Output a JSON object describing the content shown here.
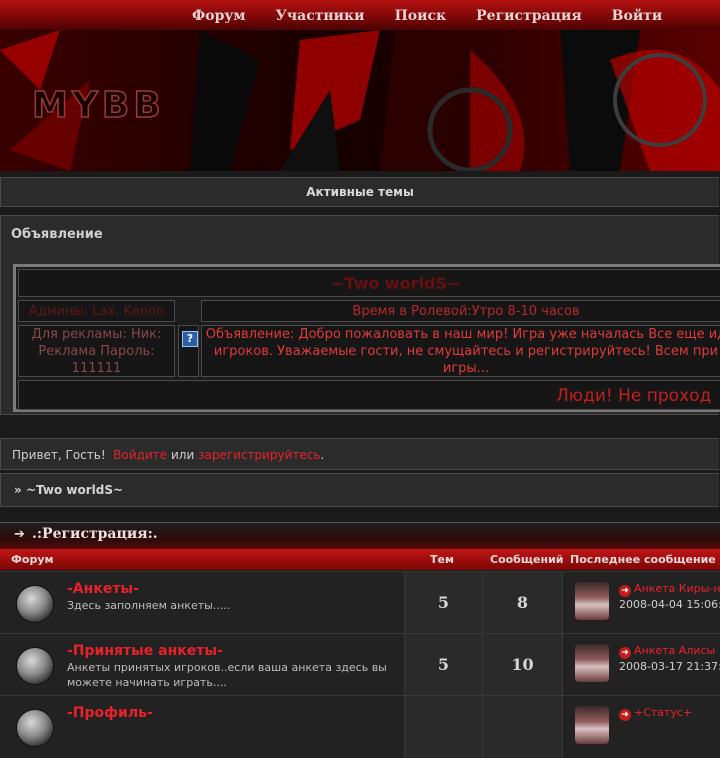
{
  "nav": {
    "items": [
      "Форум",
      "Участники",
      "Поиск",
      "Регистрация",
      "Войти"
    ]
  },
  "banner": {
    "logo_text": "MYBB"
  },
  "active_topics": "Активные темы",
  "announcement": {
    "heading": "Объявление",
    "title": "~Two worldS~",
    "admins": "Админы: Lax, Kanon",
    "time": "Время в Ролевой:Утро 8-10 часов",
    "ad_line1": "Для рекламы: Ник:",
    "ad_line2": "Реклама Пароль:",
    "ad_line3": "111111",
    "icon_glyph": "?",
    "text_line1": "Объявление: Добро пожаловать в наш мир! Игра уже началась Все еще ид",
    "text_line2": "игроков. Уважаемые гости, не смущайтесь и регистрируйтесь! Всем при",
    "text_line3": "игры...",
    "marquee": "Люди! Не проход"
  },
  "guest": {
    "greeting": "Привет, Гость!",
    "login": "Войдите",
    "or": "или",
    "register": "зарегистрируйтесь",
    "end": "."
  },
  "breadcrumb": {
    "sep": "»",
    "label": "~Two worldS~"
  },
  "category": {
    "arrow": "➔",
    "title": ".:Регистрация:."
  },
  "table_headers": {
    "forum": "Форум",
    "topics": "Тем",
    "posts": "Сообщений",
    "last": "Последнее сообщение"
  },
  "forums": [
    {
      "name": "-Анкеты-",
      "desc": "Здесь заполняем анкеты.....",
      "topics": "5",
      "posts": "8",
      "last_title": "Анкета Киры-н",
      "last_date": "2008-04-04 15:06:"
    },
    {
      "name": "-Принятые анкеты-",
      "desc": "Анкеты принятых игроков..если ваша анкета здесь вы можете начинать играть....",
      "topics": "5",
      "posts": "10",
      "last_title": "Анкета Алисы",
      "last_date": "2008-03-17 21:37:"
    },
    {
      "name": "-Профиль-",
      "desc": "",
      "topics": "",
      "posts": "",
      "last_title": "+Статус+",
      "last_date": ""
    }
  ],
  "colors": {
    "accent": "#e8212b",
    "nav_red": "#b51111",
    "panel": "#2b2b2b"
  }
}
